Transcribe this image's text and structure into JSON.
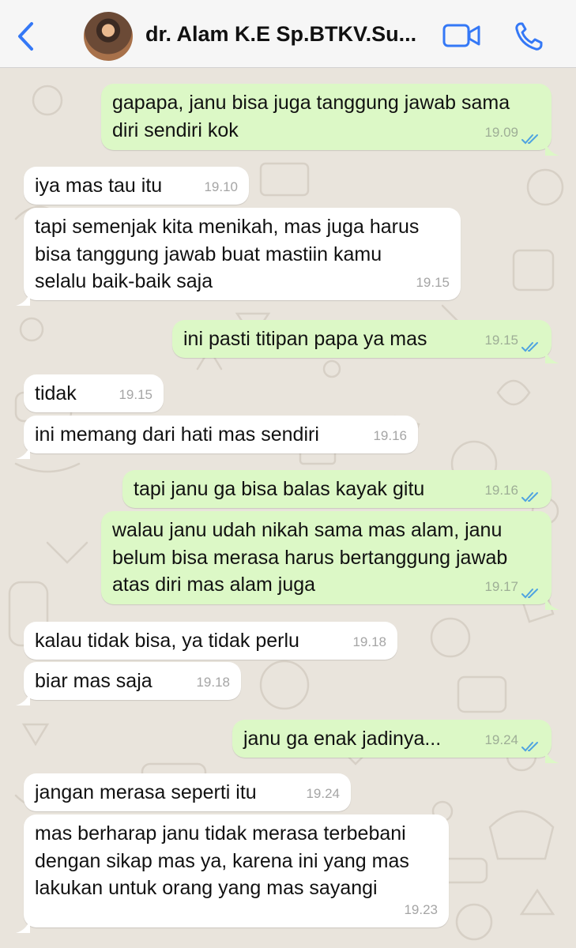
{
  "header": {
    "title": "dr. Alam K.E Sp.BTKV.Su...",
    "icons": {
      "back": "chevron-left-icon",
      "video": "video-call-icon",
      "call": "phone-icon"
    },
    "accent": "#3478f6"
  },
  "colors": {
    "incoming": "#ffffff",
    "outgoing": "#dcf8c6",
    "ticks": "#4fa3e0",
    "wallpaper": "#e9e4dc"
  },
  "messages": [
    {
      "dir": "out",
      "text": "gapapa, janu bisa juga tanggung jawab sama\ndiri sendiri kok",
      "time": "19.09",
      "read": true
    },
    {
      "dir": "in",
      "text": "iya mas tau itu",
      "time": "19.10"
    },
    {
      "dir": "in",
      "text": "tapi semenjak kita menikah, mas juga harus\nbisa tanggung jawab buat mastiin kamu\nselalu baik-baik saja",
      "time": "19.15"
    },
    {
      "dir": "out",
      "text": "ini pasti titipan papa ya mas",
      "time": "19.15",
      "read": true
    },
    {
      "dir": "in",
      "text": "tidak",
      "time": "19.15"
    },
    {
      "dir": "in",
      "text": "ini memang dari hati mas sendiri",
      "time": "19.16"
    },
    {
      "dir": "out",
      "text": "tapi janu ga bisa balas kayak gitu",
      "time": "19.16",
      "read": true
    },
    {
      "dir": "out",
      "text": "walau janu udah nikah sama mas alam, janu\nbelum bisa merasa harus bertanggung jawab\natas diri mas alam juga",
      "time": "19.17",
      "read": true
    },
    {
      "dir": "in",
      "text": "kalau tidak bisa, ya tidak perlu",
      "time": "19.18"
    },
    {
      "dir": "in",
      "text": "biar mas saja",
      "time": "19.18"
    },
    {
      "dir": "out",
      "text": "janu ga enak jadinya...",
      "time": "19.24",
      "read": true
    },
    {
      "dir": "in",
      "text": "jangan merasa seperti itu",
      "time": "19.24"
    },
    {
      "dir": "in",
      "text": "mas berharap janu tidak merasa terbebani\ndengan sikap mas ya, karena ini yang mas\nlakukan untuk orang yang mas sayangi",
      "time": "19.23"
    }
  ]
}
